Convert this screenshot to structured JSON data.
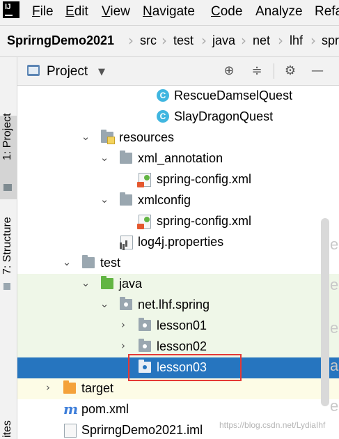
{
  "menu": {
    "app_logo": "IJ",
    "items": [
      {
        "mnemonic": "F",
        "rest": "ile"
      },
      {
        "mnemonic": "E",
        "rest": "dit"
      },
      {
        "mnemonic": "V",
        "rest": "iew"
      },
      {
        "mnemonic": "N",
        "rest": "avigate"
      },
      {
        "mnemonic": "C",
        "rest": "ode"
      },
      {
        "mnemonic": "",
        "rest": "Analyze"
      },
      {
        "mnemonic": "",
        "rest": "Refa"
      }
    ]
  },
  "breadcrumb": [
    "SprirngDemo2021",
    "src",
    "test",
    "java",
    "net",
    "lhf",
    "spr"
  ],
  "left_tabs": {
    "project": "1: Project",
    "structure": "7: Structure",
    "bottom_fragment": "ites"
  },
  "panel": {
    "title": "Project",
    "tool_icons": [
      "locate-icon",
      "collapse-icon",
      "gear-icon",
      "minimize-icon"
    ]
  },
  "tree": [
    {
      "label": "RescueDamselQuest",
      "icon": "class-icon",
      "arrow": ""
    },
    {
      "label": "SlayDragonQuest",
      "icon": "class-icon",
      "arrow": ""
    },
    {
      "label": "resources",
      "icon": "resources-folder-icon",
      "arrow": "expanded"
    },
    {
      "label": "xml_annotation",
      "icon": "folder-icon",
      "arrow": "expanded"
    },
    {
      "label": "spring-config.xml",
      "icon": "spring-xml-icon",
      "arrow": ""
    },
    {
      "label": "xmlconfig",
      "icon": "folder-icon",
      "arrow": "expanded"
    },
    {
      "label": "spring-config.xml",
      "icon": "spring-xml-icon",
      "arrow": ""
    },
    {
      "label": "log4j.properties",
      "icon": "properties-icon",
      "arrow": ""
    },
    {
      "label": "test",
      "icon": "folder-icon",
      "arrow": "expanded"
    },
    {
      "label": "java",
      "icon": "test-source-folder-icon",
      "arrow": "expanded"
    },
    {
      "label": "net.lhf.spring",
      "icon": "package-icon",
      "arrow": "expanded"
    },
    {
      "label": "lesson01",
      "icon": "package-icon",
      "arrow": "collapsed"
    },
    {
      "label": "lesson02",
      "icon": "package-icon",
      "arrow": "collapsed"
    },
    {
      "label": "lesson03",
      "icon": "package-icon",
      "arrow": "",
      "selected": true
    },
    {
      "label": "target",
      "icon": "excluded-folder-icon",
      "arrow": "collapsed"
    },
    {
      "label": "pom.xml",
      "icon": "maven-icon",
      "arrow": ""
    },
    {
      "label": "SprirngDemo2021.iml",
      "icon": "iml-file-icon",
      "arrow": ""
    }
  ],
  "watermark": "https://blog.csdn.net/LydiaIhf",
  "colors": {
    "selection": "#2675bf",
    "test_highlight": "#eff7e8",
    "excluded_highlight": "#fdfce6",
    "annotation_box": "#e53935"
  }
}
